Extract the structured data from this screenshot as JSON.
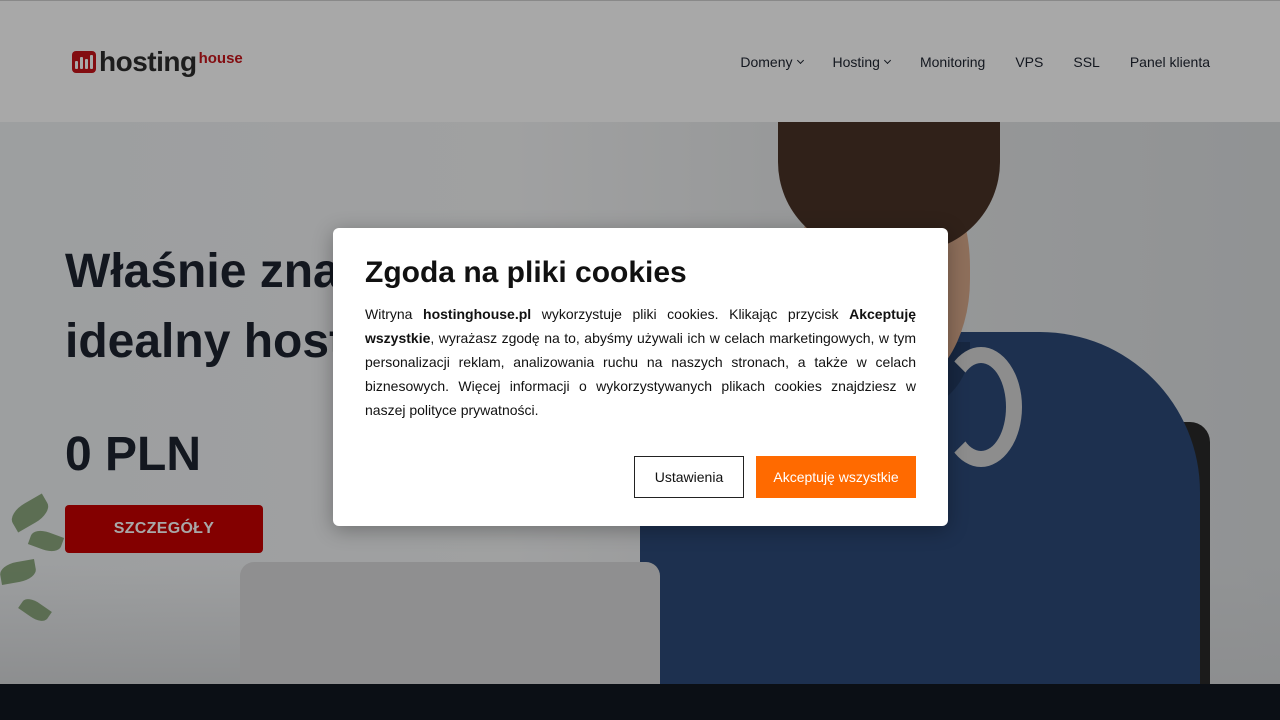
{
  "header": {
    "logo": {
      "word1": "hosting",
      "word2": "house"
    },
    "nav": [
      {
        "label": "Domeny",
        "has_dropdown": true
      },
      {
        "label": "Hosting",
        "has_dropdown": true
      },
      {
        "label": "Monitoring",
        "has_dropdown": false
      },
      {
        "label": "VPS",
        "has_dropdown": false
      },
      {
        "label": "SSL",
        "has_dropdown": false
      },
      {
        "label": "Panel klienta",
        "has_dropdown": false
      }
    ]
  },
  "hero": {
    "title": "Właśnie znalazłeś idealny hosting",
    "price": "0 PLN",
    "button": "SZCZEGÓŁY"
  },
  "cookie_modal": {
    "title": "Zgoda na pliki cookies",
    "body_1": "Witryna ",
    "site": "hostinghouse.pl",
    "body_2": " wykorzystuje pliki cookies. Klikając przycisk ",
    "accept_ref": "Akceptuję wszystkie",
    "body_3": ", wyrażasz zgodę na to, abyśmy używali ich w celach marketingowych, w tym personalizacji reklam, analizowania ruchu na naszych stronach, a także w celach biznesowych. Więcej informacji o wykorzystywanych plikach cookies znajdziesz w naszej polityce prywatności.",
    "settings_button": "Ustawienia",
    "accept_button": "Akceptuję wszystkie"
  },
  "colors": {
    "brand_red": "#c7141b",
    "cta_red": "#c70000",
    "accept_orange": "#ff6a00",
    "dark_text": "#1e2430",
    "footer": "#121720"
  }
}
